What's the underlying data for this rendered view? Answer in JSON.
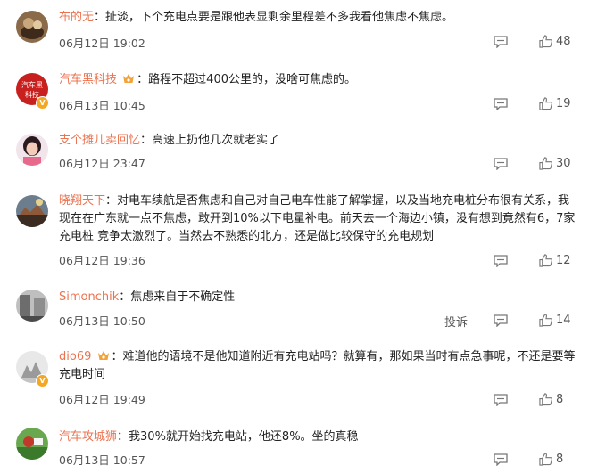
{
  "comments": [
    {
      "user": "布的无",
      "sep": "：",
      "text": "扯淡，下个充电点要是跟他表显剩余里程差不多我看他焦虑不焦虑。",
      "date": "06月12日 19:02",
      "likes": "48",
      "vip": false,
      "report": ""
    },
    {
      "user": "汽车黑科技",
      "sep": "：",
      "text": "路程不超过400公里的，没啥可焦虑的。",
      "date": "06月13日 10:45",
      "likes": "19",
      "vip": true,
      "report": ""
    },
    {
      "user": "支个摊儿卖回忆",
      "sep": "：",
      "text": "高速上扔他几次就老实了",
      "date": "06月12日 23:47",
      "likes": "30",
      "vip": false,
      "report": ""
    },
    {
      "user": "晓翔天下",
      "sep": "：",
      "text": "对电车续航是否焦虑和自己对自己电车性能了解掌握，以及当地充电桩分布很有关系，我现在在广东就一点不焦虑，敢开到10%以下电量补电。前天去一个海边小镇，没有想到竟然有6，7家充电桩 竞争太激烈了。当然去不熟悉的北方，还是做比较保守的充电规划",
      "date": "06月12日 19:36",
      "likes": "12",
      "vip": false,
      "report": ""
    },
    {
      "user": "Simonchik",
      "sep": "：",
      "text": "焦虑来自于不确定性",
      "date": "06月13日 10:50",
      "likes": "14",
      "vip": false,
      "report": "投诉"
    },
    {
      "user": "dio69",
      "sep": "：",
      "text": "难道他的语境不是他知道附近有充电站吗？就算有，那如果当时有点急事呢，不还是要等充电时间",
      "date": "06月12日 19:49",
      "likes": "8",
      "vip": true,
      "report": ""
    },
    {
      "user": "汽车攻城狮",
      "sep": "：",
      "text": "我30%就开始找充电站，他还8%。坐的真稳",
      "date": "06月13日 10:57",
      "likes": "8",
      "vip": false,
      "report": ""
    }
  ]
}
